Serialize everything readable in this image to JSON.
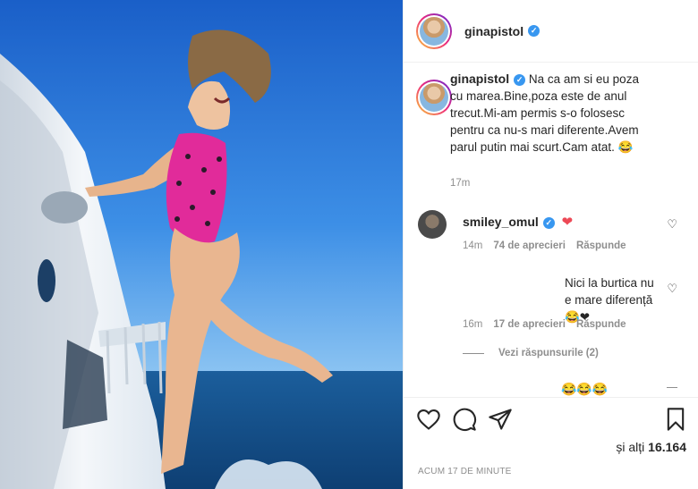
{
  "post": {
    "username": "ginapistol",
    "verified_badge": "✓",
    "photo_description_icon": "photo"
  },
  "caption": {
    "username": "ginapistol",
    "text": "Na ca am si eu poza cu marea.Bine,poza este de anul trecut.Mi-am permis s-o folosesc pentru ca nu-s mari diferente.Avem parul putin mai scurt.Cam atat. 😂",
    "time": "17m"
  },
  "comments": [
    {
      "username": "smiley_omul",
      "text": "❤",
      "time": "14m",
      "likes": "74 de aprecieri",
      "reply": "Răspunde"
    },
    {
      "text": "Nici la burtica nu e mare diferență😂❤",
      "time": "16m",
      "likes": "17 de aprecieri",
      "reply": "Răspunde"
    }
  ],
  "view_replies": "Vezi răspunsurile (2)",
  "third_comment_preview": "😂😂😂",
  "footer": {
    "likes_prefix": "și alți",
    "likes_count": "16.164",
    "timestamp": "ACUM 17 DE MINUTE"
  },
  "colors": {
    "verified": "#3897f0",
    "heart": "#ed4956",
    "muted": "#8e8e8e"
  }
}
